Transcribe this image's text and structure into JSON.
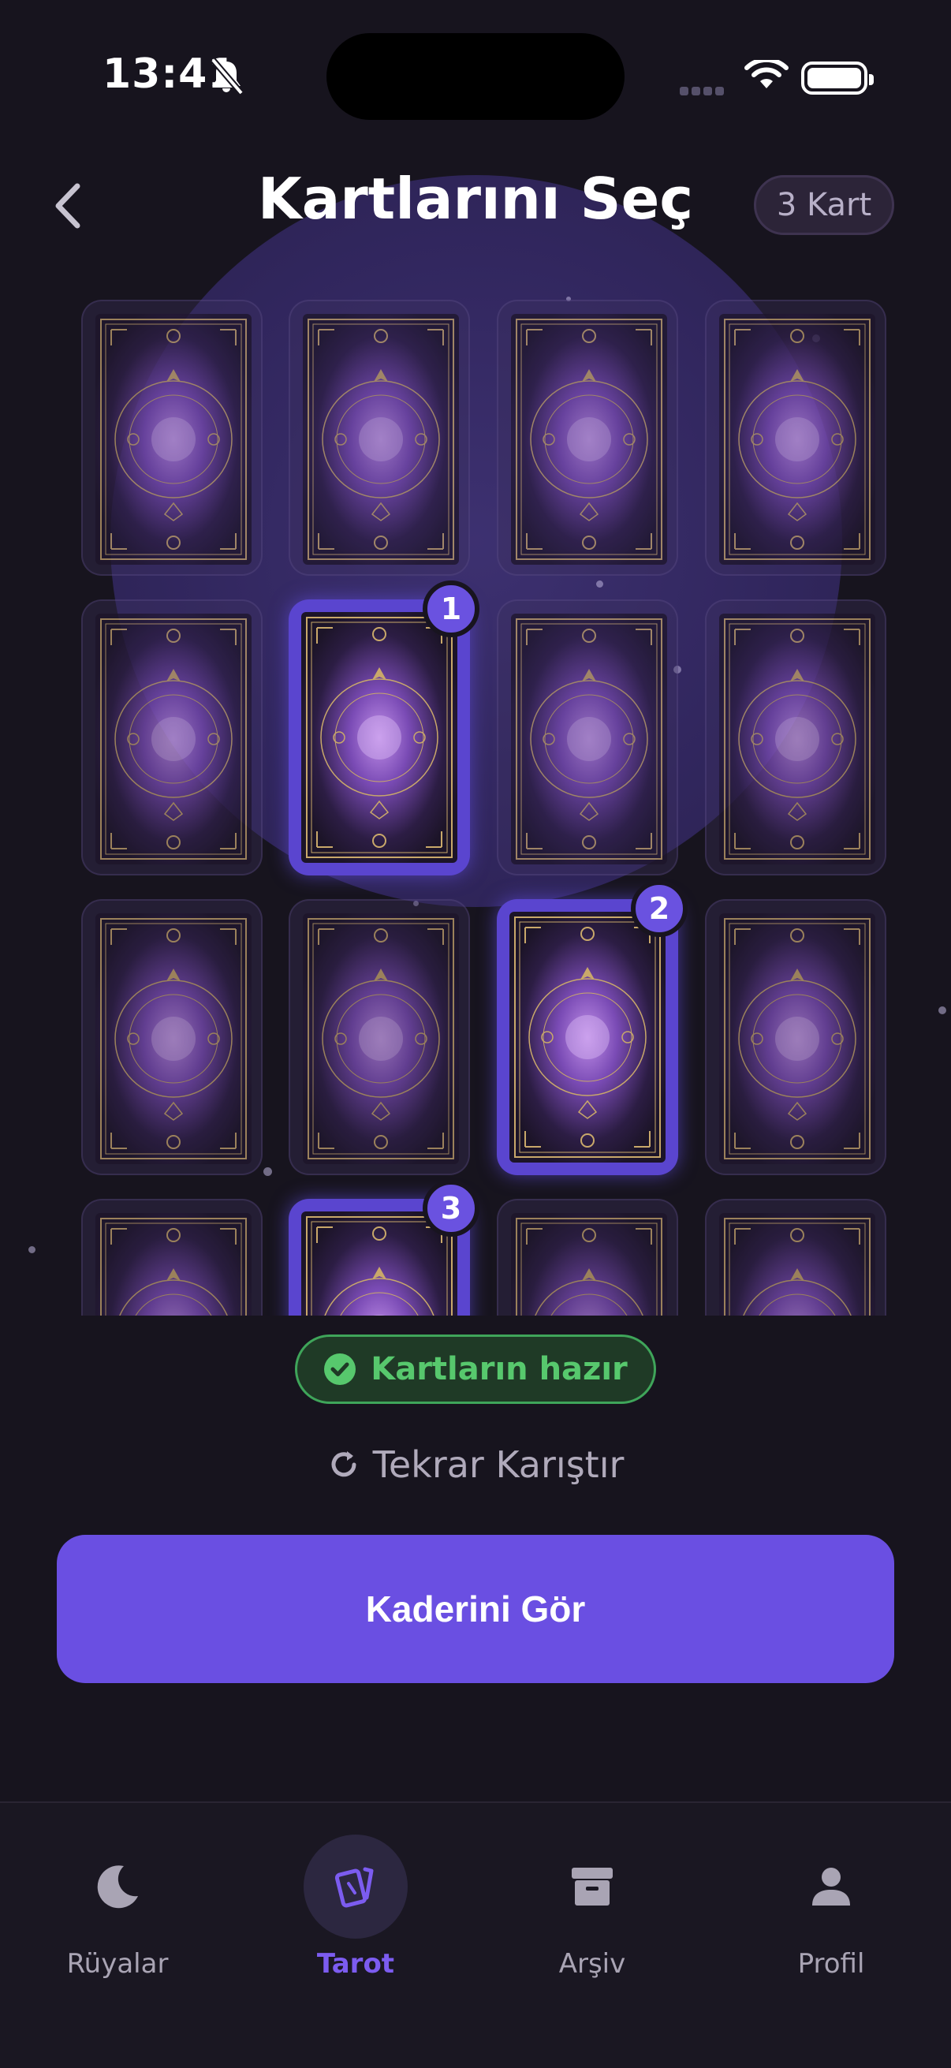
{
  "status_bar": {
    "time": "13:41"
  },
  "header": {
    "title": "Kartlarını Seç",
    "count_badge": "3 Kart"
  },
  "selected_cards": [
    {
      "number": "1"
    },
    {
      "number": "2"
    },
    {
      "number": "3"
    }
  ],
  "ready_pill": {
    "label": "Kartların hazır"
  },
  "reshuffle": {
    "label": "Tekrar Karıştır"
  },
  "cta": {
    "label": "Kaderini Gör"
  },
  "tabbar": {
    "items": [
      {
        "label": "Rüyalar",
        "icon": "moon-icon",
        "active": false
      },
      {
        "label": "Tarot",
        "icon": "cards-icon",
        "active": true
      },
      {
        "label": "Arşiv",
        "icon": "archive-icon",
        "active": false
      },
      {
        "label": "Profil",
        "icon": "person-icon",
        "active": false
      }
    ]
  },
  "colors": {
    "background": "#17141e",
    "accent": "#6a4fe2",
    "success": "#57c86d",
    "card_gold": "#c9a86a"
  }
}
